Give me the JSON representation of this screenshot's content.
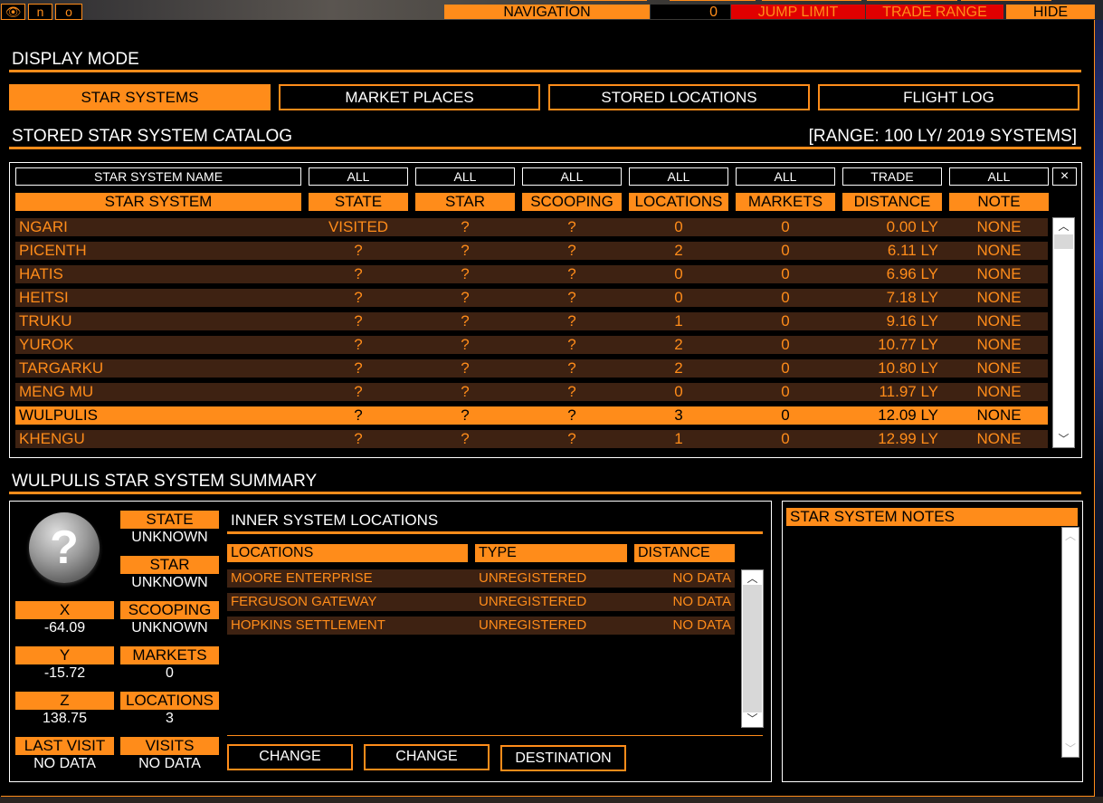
{
  "topbar": {
    "view_icon": "eye-icon",
    "n_label": "n",
    "o_label": "o",
    "navigation": "NAVIGATION",
    "count": "0",
    "jump_limit": "JUMP LIMIT",
    "trade_range": "TRADE RANGE",
    "hide": "HIDE"
  },
  "display_mode": {
    "title": "DISPLAY MODE",
    "buttons": [
      "STAR SYSTEMS",
      "MARKET PLACES",
      "STORED LOCATIONS",
      "FLIGHT LOG"
    ]
  },
  "catalog": {
    "title": "STORED STAR SYSTEM CATALOG",
    "range": "[RANGE: 100 LY/ 2019 SYSTEMS]",
    "filters": [
      "STAR SYSTEM NAME",
      "ALL",
      "ALL",
      "ALL",
      "ALL",
      "ALL",
      "TRADE",
      "ALL"
    ],
    "close": "×",
    "columns": [
      "STAR SYSTEM",
      "STATE",
      "STAR",
      "SCOOPING",
      "LOCATIONS",
      "MARKETS",
      "DISTANCE",
      "NOTE"
    ],
    "rows": [
      {
        "name": "NGARI",
        "state": "VISITED",
        "star": "?",
        "scooping": "?",
        "locations": "0",
        "markets": "0",
        "distance": "0.00 LY",
        "note": "NONE"
      },
      {
        "name": "PICENTH",
        "state": "?",
        "star": "?",
        "scooping": "?",
        "locations": "2",
        "markets": "0",
        "distance": "6.11 LY",
        "note": "NONE"
      },
      {
        "name": "HATIS",
        "state": "?",
        "star": "?",
        "scooping": "?",
        "locations": "0",
        "markets": "0",
        "distance": "6.96 LY",
        "note": "NONE"
      },
      {
        "name": "HEITSI",
        "state": "?",
        "star": "?",
        "scooping": "?",
        "locations": "0",
        "markets": "0",
        "distance": "7.18 LY",
        "note": "NONE"
      },
      {
        "name": "TRUKU",
        "state": "?",
        "star": "?",
        "scooping": "?",
        "locations": "1",
        "markets": "0",
        "distance": "9.16 LY",
        "note": "NONE"
      },
      {
        "name": "YUROK",
        "state": "?",
        "star": "?",
        "scooping": "?",
        "locations": "2",
        "markets": "0",
        "distance": "10.77 LY",
        "note": "NONE"
      },
      {
        "name": "TARGARKU",
        "state": "?",
        "star": "?",
        "scooping": "?",
        "locations": "2",
        "markets": "0",
        "distance": "10.80 LY",
        "note": "NONE"
      },
      {
        "name": "MENG MU",
        "state": "?",
        "star": "?",
        "scooping": "?",
        "locations": "0",
        "markets": "0",
        "distance": "11.97 LY",
        "note": "NONE"
      },
      {
        "name": "WULPULIS",
        "state": "?",
        "star": "?",
        "scooping": "?",
        "locations": "3",
        "markets": "0",
        "distance": "12.09 LY",
        "note": "NONE"
      },
      {
        "name": "KHENGU",
        "state": "?",
        "star": "?",
        "scooping": "?",
        "locations": "1",
        "markets": "0",
        "distance": "12.99 LY",
        "note": "NONE"
      }
    ]
  },
  "summary": {
    "title": "WULPULIS STAR SYSTEM SUMMARY",
    "icon": "question-mark-icon",
    "state_label": "STATE",
    "state_value": "UNKNOWN",
    "star_label": "STAR",
    "star_value": "UNKNOWN",
    "scooping_label": "SCOOPING",
    "scooping_value": "UNKNOWN",
    "markets_label": "MARKETS",
    "markets_value": "0",
    "locations_label": "LOCATIONS",
    "locations_value": "3",
    "visits_label": "VISITS",
    "visits_value": "NO DATA",
    "x_label": "X",
    "x_value": "-64.09",
    "y_label": "Y",
    "y_value": "-15.72",
    "z_label": "Z",
    "z_value": "138.75",
    "last_visit_label": "LAST VISIT",
    "last_visit_value": "NO DATA"
  },
  "inner": {
    "title": "INNER SYSTEM LOCATIONS",
    "columns": [
      "LOCATIONS",
      "TYPE",
      "DISTANCE"
    ],
    "rows": [
      {
        "name": "MOORE ENTERPRISE",
        "type": "UNREGISTERED",
        "distance": "NO DATA"
      },
      {
        "name": "FERGUSON GATEWAY",
        "type": "UNREGISTERED",
        "distance": "NO DATA"
      },
      {
        "name": "HOPKINS SETTLEMENT",
        "type": "UNREGISTERED",
        "distance": "NO DATA"
      }
    ],
    "buttons": [
      "CHANGE",
      "CHANGE",
      "DESTINATION"
    ]
  },
  "notes": {
    "title": "STAR SYSTEM NOTES"
  }
}
